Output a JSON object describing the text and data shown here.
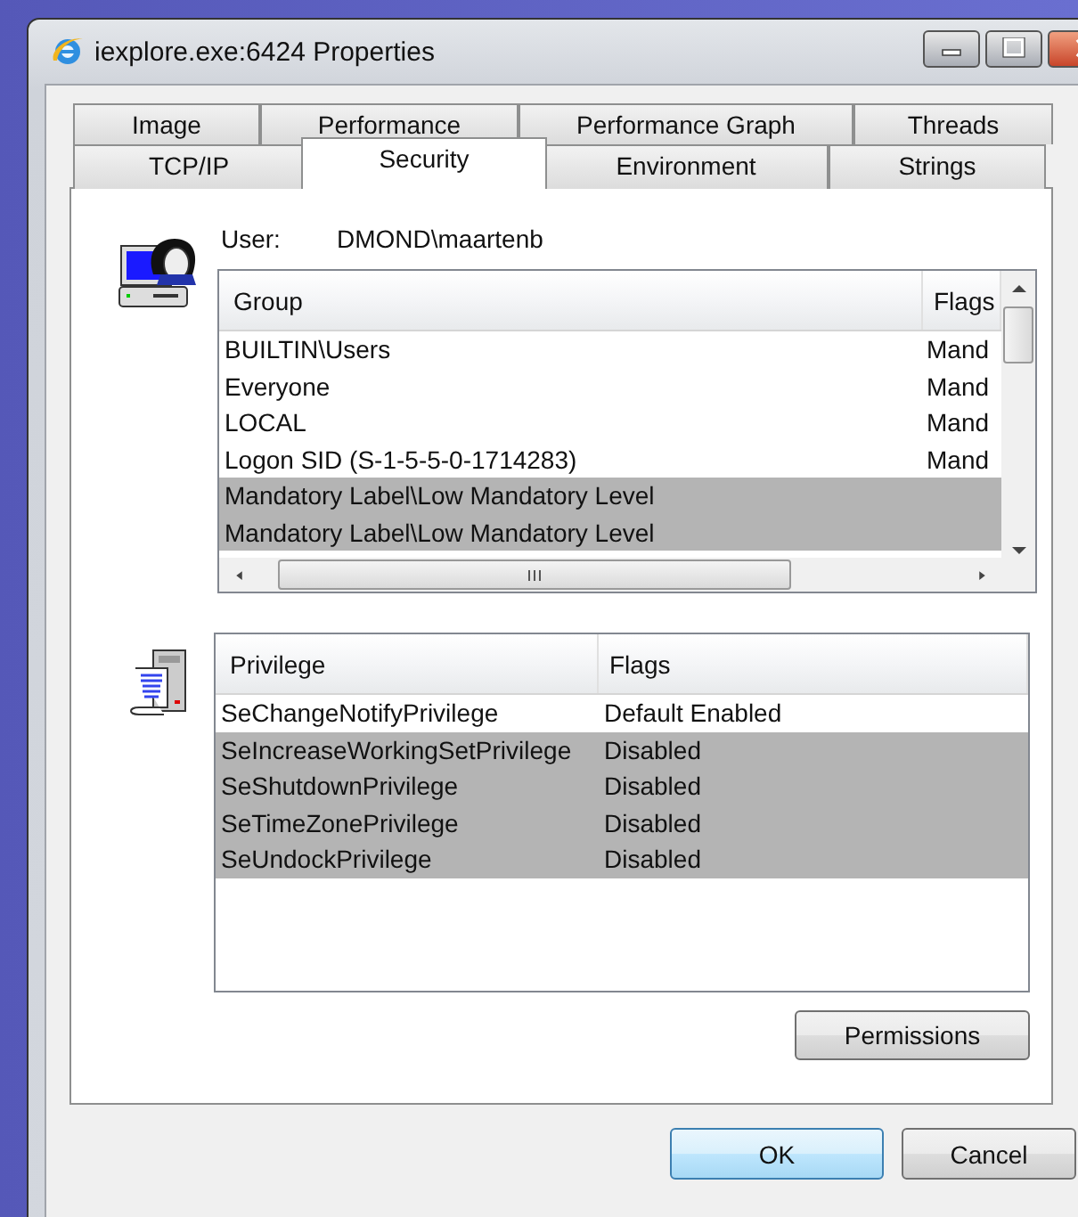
{
  "window": {
    "title": "iexplore.exe:6424 Properties"
  },
  "tab_rows": [
    [
      {
        "label": "Image",
        "selected": false
      },
      {
        "label": "Performance",
        "selected": false
      },
      {
        "label": "Performance Graph",
        "selected": false
      },
      {
        "label": "Threads",
        "selected": false
      }
    ],
    [
      {
        "label": "TCP/IP",
        "selected": false
      },
      {
        "label": "Security",
        "selected": true
      },
      {
        "label": "Environment",
        "selected": false
      },
      {
        "label": "Strings",
        "selected": false
      }
    ]
  ],
  "user": {
    "label": "User:",
    "value": "DMOND\\maartenb"
  },
  "groups": {
    "columns": [
      "Group",
      "Flags"
    ],
    "rows": [
      {
        "group": "BUILTIN\\Users",
        "flags": "Mand",
        "selected": false
      },
      {
        "group": "Everyone",
        "flags": "Mand",
        "selected": false
      },
      {
        "group": "LOCAL",
        "flags": "Mand",
        "selected": false
      },
      {
        "group": "Logon SID (S-1-5-5-0-1714283)",
        "flags": "Mand",
        "selected": false
      },
      {
        "group": "Mandatory Label\\Low Mandatory Level",
        "selected": true
      },
      {
        "group": "Mandatory Label\\Low Mandatory Level",
        "selected": true
      }
    ]
  },
  "privileges": {
    "columns": [
      "Privilege",
      "Flags"
    ],
    "rows": [
      {
        "privilege": "SeChangeNotifyPrivilege",
        "flags": "Default Enabled",
        "selected": false
      },
      {
        "privilege": "SeIncreaseWorkingSetPrivilege",
        "flags": "Disabled",
        "selected": true
      },
      {
        "privilege": "SeShutdownPrivilege",
        "flags": "Disabled",
        "selected": true
      },
      {
        "privilege": "SeTimeZonePrivilege",
        "flags": "Disabled",
        "selected": true
      },
      {
        "privilege": "SeUndockPrivilege",
        "flags": "Disabled",
        "selected": true
      }
    ]
  },
  "buttons": {
    "permissions": "Permissions",
    "ok": "OK",
    "cancel": "Cancel"
  }
}
